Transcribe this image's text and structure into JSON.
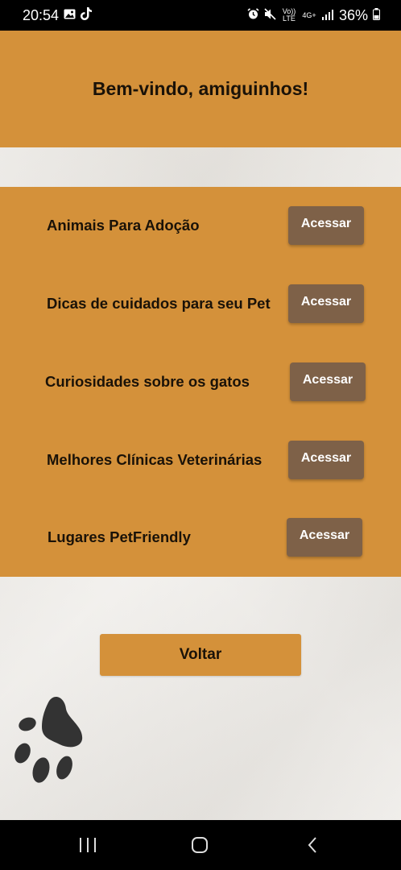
{
  "status_bar": {
    "time": "20:54",
    "battery": "36%",
    "left_icons": [
      "gallery-icon",
      "tiktok-icon"
    ],
    "right_icons": [
      "alarm-icon",
      "mute-icon",
      "volte-icon",
      "4g-icon",
      "signal-icon",
      "battery-icon"
    ],
    "volte_label": "Vo)) LTE",
    "network_label": "4G+"
  },
  "header": {
    "title": "Bem-vindo, amiguinhos!"
  },
  "menu": {
    "items": [
      {
        "label": "Animais Para Adoção",
        "button": "Acessar"
      },
      {
        "label": "Dicas de cuidados para seu Pet",
        "button": "Acessar"
      },
      {
        "label": "Curiosidades sobre os gatos",
        "button": "Acessar"
      },
      {
        "label": "Melhores Clínicas Veterinárias",
        "button": "Acessar"
      },
      {
        "label": "Lugares PetFriendly",
        "button": "Acessar"
      }
    ]
  },
  "back_button": {
    "label": "Voltar"
  },
  "decoration": {
    "icon": "paw-print-icon"
  },
  "nav_bar": {
    "icons": [
      "recent-apps-icon",
      "home-icon",
      "back-icon"
    ]
  },
  "colors": {
    "accent": "#d4913a",
    "button": "#7e6148",
    "background": "#ebe8e3",
    "text": "#1a1208"
  }
}
